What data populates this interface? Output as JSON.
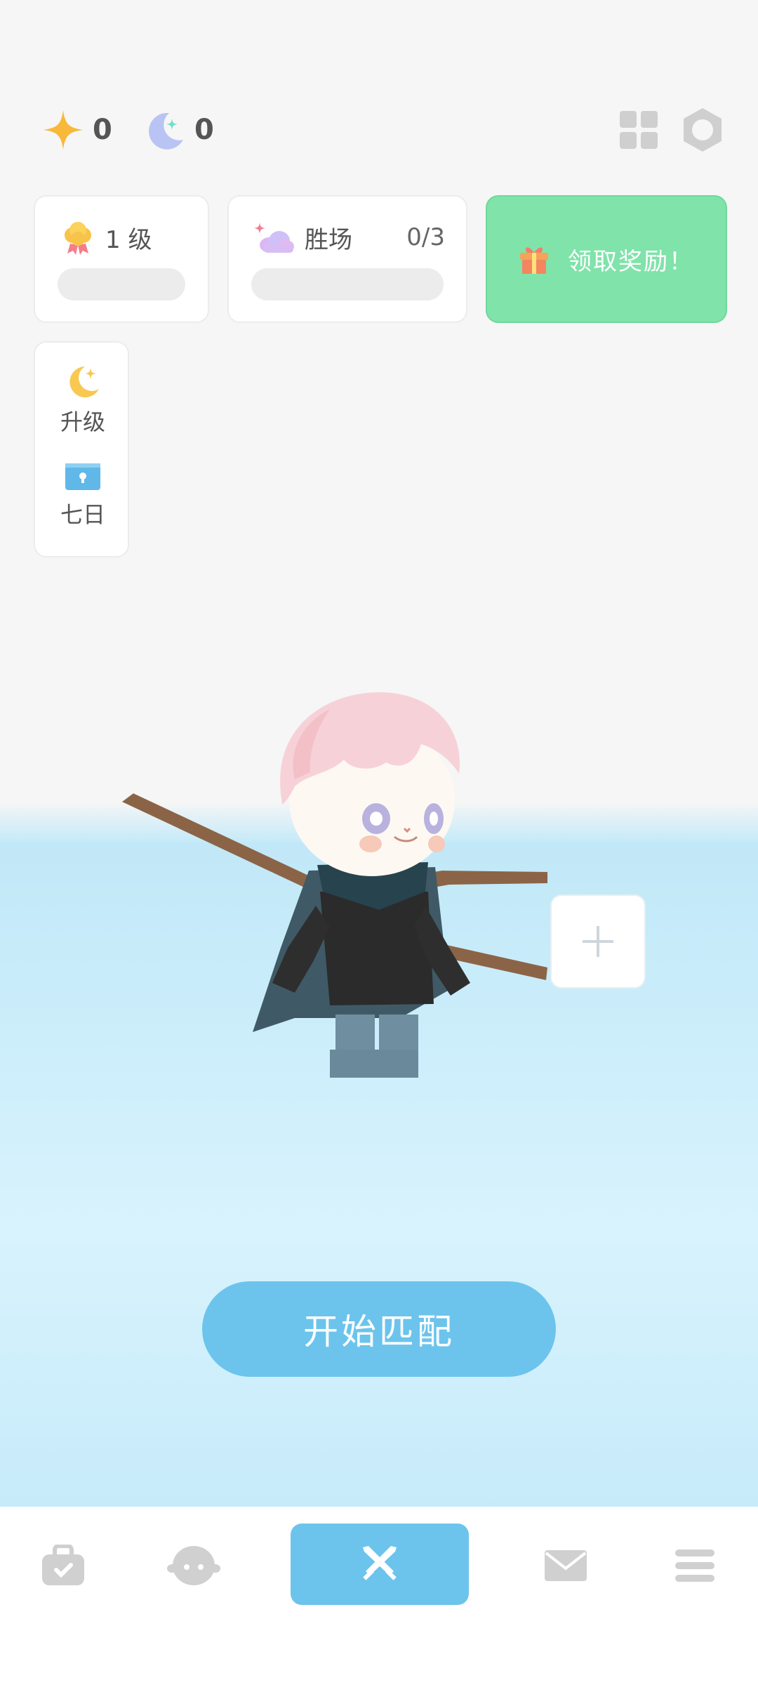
{
  "currency": {
    "stars": "0",
    "moons": "0"
  },
  "level_card": {
    "label": "1 级",
    "progress": 0
  },
  "wins_card": {
    "label": "胜场",
    "count": "0/3",
    "progress": 0
  },
  "reward_button": {
    "label": "领取奖励！"
  },
  "side_panel": {
    "items": [
      {
        "label": "升级",
        "icon": "moon-star-icon"
      },
      {
        "label": "七日",
        "icon": "chest-icon"
      }
    ]
  },
  "match_button": {
    "label": "开始匹配"
  },
  "bottom_nav": {
    "items": [
      {
        "icon": "bag-icon"
      },
      {
        "icon": "character-face-icon"
      },
      {
        "icon": "crossed-swords-icon",
        "active": true
      },
      {
        "icon": "mail-icon"
      },
      {
        "icon": "menu-icon"
      }
    ]
  },
  "colors": {
    "accent_blue": "#6cc4ec",
    "reward_green": "#80e3aa",
    "water": "#c7ebfa"
  }
}
